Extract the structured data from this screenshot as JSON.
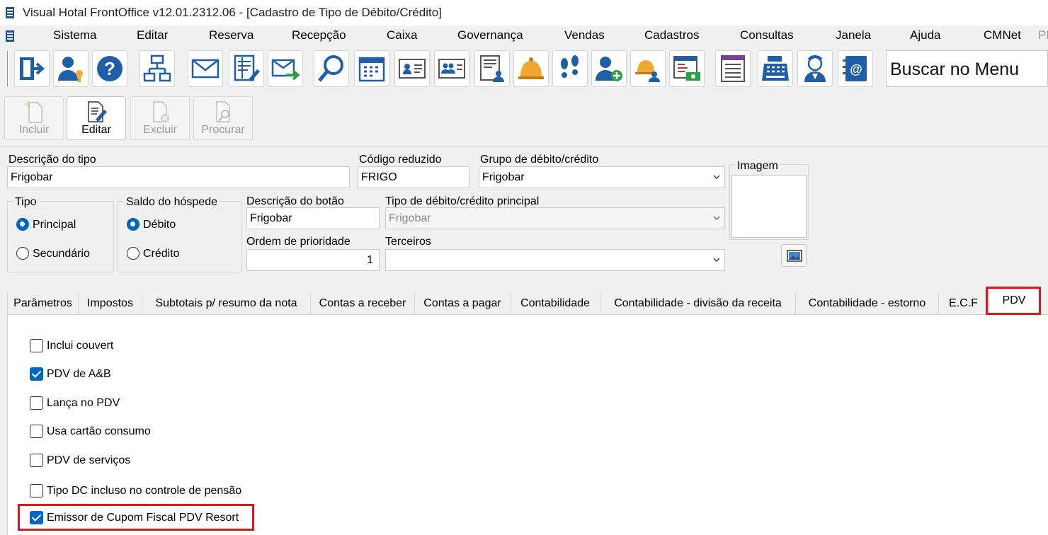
{
  "window": {
    "title": "Visual Hotal FrontOffice v12.01.2312.06 - [Cadastro de Tipo de Débito/Crédito]"
  },
  "menu": [
    "Sistema",
    "Editar",
    "Reserva",
    "Recepção",
    "Caixa",
    "Governança",
    "Vendas",
    "Cadastros",
    "Consultas",
    "Janela",
    "Ajuda",
    "CMNet",
    "PL"
  ],
  "toolbar": {
    "icons": [
      "exit-icon",
      "user-key-icon",
      "help-icon",
      "org-chart-icon",
      "mail-icon",
      "sheet-edit-icon",
      "mail-send-icon",
      "search-icon",
      "calendar-icon",
      "id-card-icon",
      "id-card-group-icon",
      "report-users-icon",
      "bell-icon",
      "footprints-icon",
      "add-user-icon",
      "bell-users-icon",
      "cash-report-icon",
      "list-form-icon",
      "cash-register-icon",
      "maid-icon",
      "contact-book-icon"
    ],
    "search_label": "Buscar no Menu"
  },
  "actions": {
    "incluir": "Incluir",
    "editar": "Editar",
    "excluir": "Excluir",
    "procurar": "Procurar"
  },
  "form": {
    "descricao_tipo": {
      "label": "Descrição do tipo",
      "value": "Frigobar"
    },
    "codigo_reduzido": {
      "label": "Código reduzido",
      "value": "FRIGO"
    },
    "grupo": {
      "label": "Grupo de débito/crédito",
      "value": "Frigobar"
    },
    "imagem": {
      "label": "Imagem"
    },
    "tipo": {
      "label": "Tipo",
      "options": [
        "Principal",
        "Secundário"
      ],
      "selected": "Principal"
    },
    "saldo": {
      "label": "Saldo do hóspede",
      "options": [
        "Débito",
        "Crédito"
      ],
      "selected": "Débito"
    },
    "descricao_botao": {
      "label": "Descrição do botão",
      "value": "Frigobar"
    },
    "tipo_principal": {
      "label": "Tipo de débito/crédito principal",
      "value": "Frigobar"
    },
    "ordem": {
      "label": "Ordem de prioridade",
      "value": "1"
    },
    "terceiros": {
      "label": "Terceiros",
      "value": ""
    }
  },
  "tabs": [
    "Parâmetros",
    "Impostos",
    "Subtotais p/ resumo da nota",
    "Contas a receber",
    "Contas a pagar",
    "Contabilidade",
    "Contabilidade - divisão da receita",
    "Contabilidade - estorno",
    "E.C.F",
    "PDV"
  ],
  "active_tab": "PDV",
  "pdv": {
    "checks": [
      {
        "label": "Inclui couvert",
        "checked": false
      },
      {
        "label": "PDV de A&B",
        "checked": true
      },
      {
        "label": "Lança no PDV",
        "checked": false
      },
      {
        "label": "Usa cartão consumo",
        "checked": false
      },
      {
        "label": "PDV de serviços",
        "checked": false
      },
      {
        "label": "Tipo DC incluso no controle de pensão",
        "checked": false
      },
      {
        "label": "Emissor de Cupom Fiscal PDV Resort",
        "checked": true
      }
    ]
  },
  "colors": {
    "accent": "#0067c0",
    "highlight": "#d71920",
    "icon_blue": "#1f5fa8",
    "icon_gold": "#f0a830"
  }
}
